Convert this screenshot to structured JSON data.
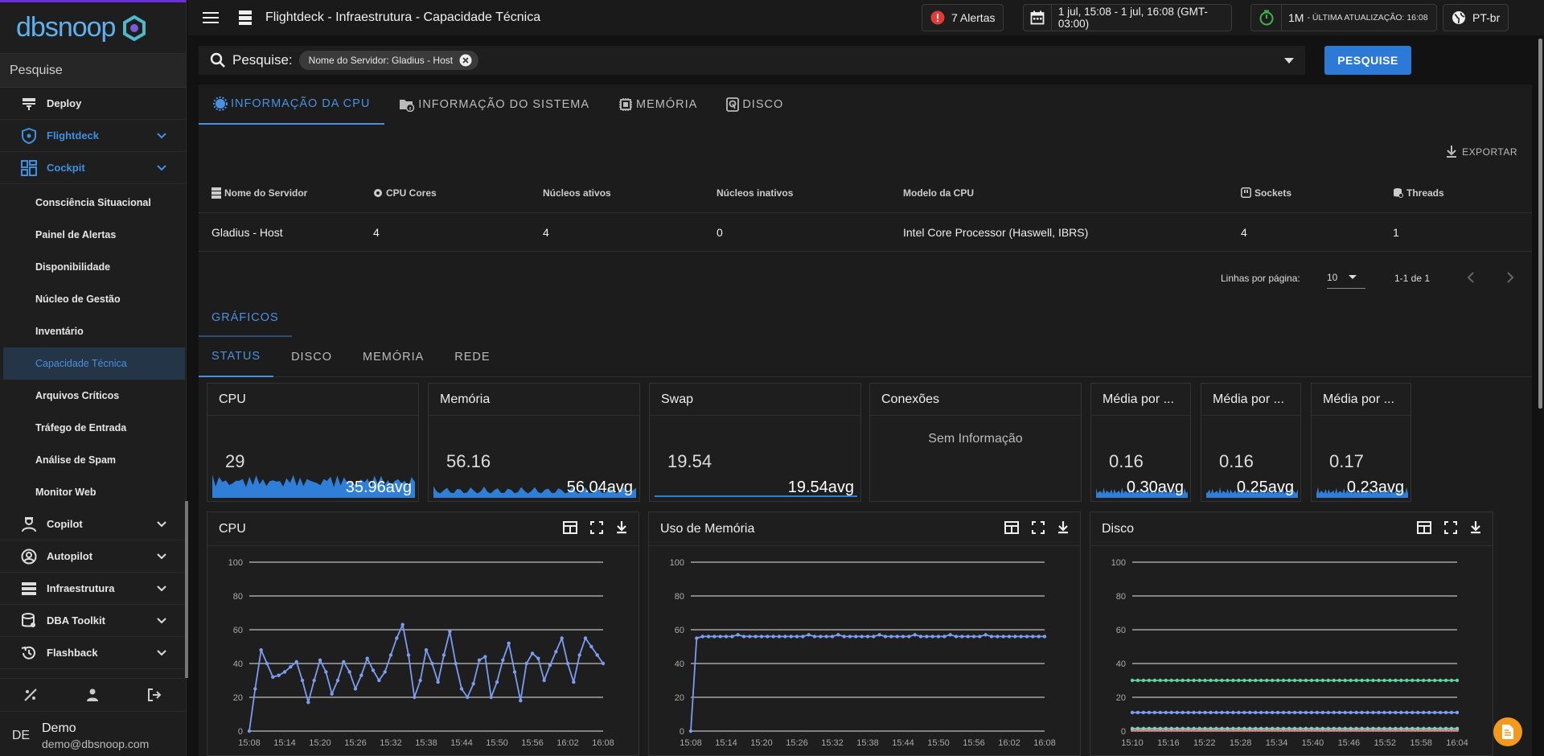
{
  "brand": {
    "wordmark": "dbsnoop"
  },
  "sidebar": {
    "search_label": "Pesquise",
    "items": [
      {
        "label": "Deploy",
        "icon": "deploy-icon"
      },
      {
        "label": "Flightdeck",
        "icon": "shield-icon"
      },
      {
        "label": "Cockpit",
        "icon": "dashboard-grid-icon"
      },
      {
        "label": "Copilot",
        "icon": "pilot-icon"
      },
      {
        "label": "Autopilot",
        "icon": "user-gear-icon"
      },
      {
        "label": "Infraestrutura",
        "icon": "server-icon"
      },
      {
        "label": "DBA Toolkit",
        "icon": "database-gear-icon"
      },
      {
        "label": "Flashback",
        "icon": "history-icon"
      }
    ],
    "cockpit_sub": [
      "Consciência Situacional",
      "Painel de Alertas",
      "Disponibilidade",
      "Núcleo de Gestão",
      "Inventário",
      "Capacidade Técnica",
      "Arquivos Críticos",
      "Tráfego de Entrada",
      "Análise de Spam",
      "Monitor Web"
    ],
    "user": {
      "initials": "DE",
      "name": "Demo",
      "email": "demo@dbsnoop.com"
    }
  },
  "header": {
    "title": "Flightdeck - Infraestrutura - Capacidade Técnica",
    "alerts_label": "7 Alertas",
    "time_range": "1 jul, 15:08 - 1 jul, 16:08 (GMT-03:00)",
    "refresh_interval": "1M",
    "last_update_label": "- ÚLTIMA ATUALIZAÇÃO: 16:08",
    "language": "PT-br"
  },
  "search": {
    "label": "Pesquise:",
    "chip": "Nome do Servidor: Gladius - Host",
    "button": "PESQUISE"
  },
  "tabs": [
    "INFORMAÇÃO DA CPU",
    "INFORMAÇÃO DO SISTEMA",
    "MEMÓRIA",
    "DISCO"
  ],
  "export_label": "EXPORTAR",
  "table": {
    "headers": [
      "Nome do Servidor",
      "CPU Cores",
      "Núcleos ativos",
      "Núcleos inativos",
      "Modelo da CPU",
      "Sockets",
      "Threads"
    ],
    "rows": [
      [
        "Gladius - Host",
        "4",
        "4",
        "0",
        "Intel Core Processor (Haswell, IBRS)",
        "4",
        "1"
      ]
    ]
  },
  "pagination": {
    "rows_label": "Linhas por página:",
    "rows_value": "10",
    "range": "1-1 de 1"
  },
  "graphs_tab": "GRÁFICOS",
  "graph_subtabs": [
    "STATUS",
    "DISCO",
    "MEMÓRIA",
    "REDE"
  ],
  "stat_cards": [
    {
      "title": "CPU",
      "value": "29",
      "avg": "35.96avg"
    },
    {
      "title": "Memória",
      "value": "56.16",
      "avg": "56.04avg"
    },
    {
      "title": "Swap",
      "value": "19.54",
      "avg": "19.54avg"
    },
    {
      "title": "Conexões",
      "no_data": "Sem Informação"
    },
    {
      "title": "Média por ...",
      "value": "0.16",
      "avg": "0.30avg"
    },
    {
      "title": "Média por ...",
      "value": "0.16",
      "avg": "0.25avg"
    },
    {
      "title": "Média por ...",
      "value": "0.17",
      "avg": "0.23avg"
    }
  ],
  "colors": {
    "accent": "#4a90e2",
    "primary_button": "#2d7ad6",
    "alert": "#e53935",
    "fab": "#f39a1e",
    "spark": "#2f7fd8"
  },
  "chart_data": [
    {
      "type": "line",
      "title": "CPU",
      "x": [
        "15:08",
        "15:09",
        "15:10",
        "15:11",
        "15:12",
        "15:13",
        "15:14",
        "15:15",
        "15:16",
        "15:17",
        "15:18",
        "15:19",
        "15:20",
        "15:21",
        "15:22",
        "15:23",
        "15:24",
        "15:25",
        "15:26",
        "15:27",
        "15:28",
        "15:29",
        "15:30",
        "15:31",
        "15:32",
        "15:33",
        "15:34",
        "15:35",
        "15:36",
        "15:37",
        "15:38",
        "15:39",
        "15:40",
        "15:41",
        "15:42",
        "15:43",
        "15:44",
        "15:45",
        "15:46",
        "15:47",
        "15:48",
        "15:49",
        "15:50",
        "15:51",
        "15:52",
        "15:53",
        "15:54",
        "15:55",
        "15:56",
        "15:57",
        "15:58",
        "15:59",
        "16:00",
        "16:01",
        "16:02",
        "16:03",
        "16:04",
        "16:05",
        "16:06",
        "16:07",
        "16:08"
      ],
      "x_ticks": [
        "15:08",
        "15:14",
        "15:20",
        "15:26",
        "15:32",
        "15:38",
        "15:44",
        "15:50",
        "15:56",
        "16:02",
        "16:08"
      ],
      "series": [
        {
          "color": "#7b9cf0",
          "values": [
            0,
            25,
            48,
            40,
            32,
            33,
            35,
            38,
            41,
            30,
            17,
            30,
            42,
            35,
            22,
            30,
            41,
            35,
            25,
            33,
            43,
            36,
            30,
            35,
            45,
            55,
            63,
            45,
            20,
            30,
            48,
            40,
            29,
            45,
            59,
            40,
            25,
            20,
            28,
            42,
            44,
            20,
            29,
            42,
            52,
            35,
            18,
            40,
            46,
            43,
            30,
            39,
            47,
            55,
            40,
            29,
            45,
            55,
            50,
            45,
            40
          ]
        }
      ],
      "ylim": [
        0,
        100
      ],
      "y_ticks": [
        0,
        20,
        40,
        60,
        80,
        100
      ]
    },
    {
      "type": "line",
      "title": "Uso de Memória",
      "x": [
        "15:08",
        "15:09",
        "15:10",
        "15:11",
        "15:12",
        "15:13",
        "15:14",
        "15:15",
        "15:16",
        "15:17",
        "15:18",
        "15:19",
        "15:20",
        "15:21",
        "15:22",
        "15:23",
        "15:24",
        "15:25",
        "15:26",
        "15:27",
        "15:28",
        "15:29",
        "15:30",
        "15:31",
        "15:32",
        "15:33",
        "15:34",
        "15:35",
        "15:36",
        "15:37",
        "15:38",
        "15:39",
        "15:40",
        "15:41",
        "15:42",
        "15:43",
        "15:44",
        "15:45",
        "15:46",
        "15:47",
        "15:48",
        "15:49",
        "15:50",
        "15:51",
        "15:52",
        "15:53",
        "15:54",
        "15:55",
        "15:56",
        "15:57",
        "15:58",
        "15:59",
        "16:00",
        "16:01",
        "16:02",
        "16:03",
        "16:04",
        "16:05",
        "16:06",
        "16:07",
        "16:08"
      ],
      "x_ticks": [
        "15:08",
        "15:14",
        "15:20",
        "15:26",
        "15:32",
        "15:38",
        "15:44",
        "15:50",
        "15:56",
        "16:02",
        "16:08"
      ],
      "series": [
        {
          "color": "#7b9cf0",
          "values": [
            0,
            55,
            56,
            56,
            56,
            56,
            56,
            56,
            57,
            56,
            56,
            56,
            56,
            56,
            56,
            56,
            56,
            56,
            56,
            56,
            57,
            56,
            56,
            56,
            56,
            57,
            56,
            56,
            56,
            56,
            56,
            56,
            57,
            56,
            56,
            56,
            56,
            56,
            57,
            56,
            56,
            56,
            56,
            56,
            57,
            56,
            56,
            56,
            56,
            56,
            57,
            56,
            56,
            56,
            56,
            56,
            56,
            56,
            56,
            56,
            56
          ]
        }
      ],
      "ylim": [
        0,
        100
      ],
      "y_ticks": [
        0,
        20,
        40,
        60,
        80,
        100
      ]
    },
    {
      "type": "line",
      "title": "Disco",
      "x_ticks": [
        "15:10",
        "15:16",
        "15:22",
        "15:28",
        "15:34",
        "15:40",
        "15:46",
        "15:52",
        "15:58",
        "16:04"
      ],
      "series": [
        {
          "color": "#5fd3a0",
          "values": [
            30,
            30,
            30,
            30,
            30,
            30,
            30,
            30,
            30,
            30,
            30,
            30,
            30,
            30,
            30,
            30,
            30,
            30,
            30,
            30,
            30,
            30,
            30,
            30,
            30,
            30,
            30,
            30,
            30,
            30,
            30,
            30,
            30,
            30,
            30,
            30,
            30,
            30,
            30,
            30,
            30,
            30,
            30,
            30,
            30,
            30,
            30,
            30,
            30,
            30,
            30,
            30,
            30,
            30,
            30,
            30,
            30,
            30,
            30
          ]
        },
        {
          "color": "#7b9cf0",
          "values": [
            11,
            11,
            11,
            11,
            11,
            11,
            11,
            11,
            11,
            11,
            11,
            11,
            11,
            11,
            11,
            11,
            11,
            11,
            11,
            11,
            11,
            11,
            11,
            11,
            11,
            11,
            11,
            11,
            11,
            11,
            11,
            11,
            11,
            11,
            11,
            11,
            11,
            11,
            11,
            11,
            11,
            11,
            11,
            11,
            11,
            11,
            11,
            11,
            11,
            11,
            11,
            11,
            11,
            11,
            11,
            11,
            11,
            11,
            11
          ]
        },
        {
          "color": "#e57373",
          "values": [
            0.5,
            0.5,
            0.5,
            0.5,
            0.5,
            0.5,
            0.5,
            0.5,
            0.5,
            0.5,
            0.5,
            0.5,
            0.5,
            0.5,
            0.5,
            0.5,
            0.5,
            0.5,
            0.5,
            0.5,
            0.5,
            0.5,
            0.5,
            0.5,
            0.5,
            0.5,
            0.5,
            0.5,
            0.5,
            0.5,
            0.5,
            0.5,
            0.5,
            0.5,
            0.5,
            0.5,
            0.5,
            0.5,
            0.5,
            0.5,
            0.5,
            0.5,
            0.5,
            0.5,
            0.5,
            0.5,
            0.5,
            0.5,
            0.5,
            0.5,
            0.5,
            0.5,
            0.5,
            0.5,
            0.5,
            0.5,
            0.5,
            0.5,
            0.5
          ]
        },
        {
          "color": "#80cbc4",
          "values": [
            1.5,
            1.5,
            1.5,
            1.5,
            1.5,
            1.5,
            1.5,
            1.5,
            1.5,
            1.5,
            1.5,
            1.5,
            1.5,
            1.5,
            1.5,
            1.5,
            1.5,
            1.5,
            1.5,
            1.5,
            1.5,
            1.5,
            1.5,
            1.5,
            1.5,
            1.5,
            1.5,
            1.5,
            1.5,
            1.5,
            1.5,
            1.5,
            1.5,
            1.5,
            1.5,
            1.5,
            1.5,
            1.5,
            1.5,
            1.5,
            1.5,
            1.5,
            1.5,
            1.5,
            1.5,
            1.5,
            1.5,
            1.5,
            1.5,
            1.5,
            1.5,
            1.5,
            1.5,
            1.5,
            1.5,
            1.5,
            1.5,
            1.5,
            1.5
          ]
        }
      ],
      "ylim": [
        0,
        100
      ],
      "y_ticks": [
        0,
        20,
        40,
        60,
        80,
        100
      ]
    }
  ]
}
